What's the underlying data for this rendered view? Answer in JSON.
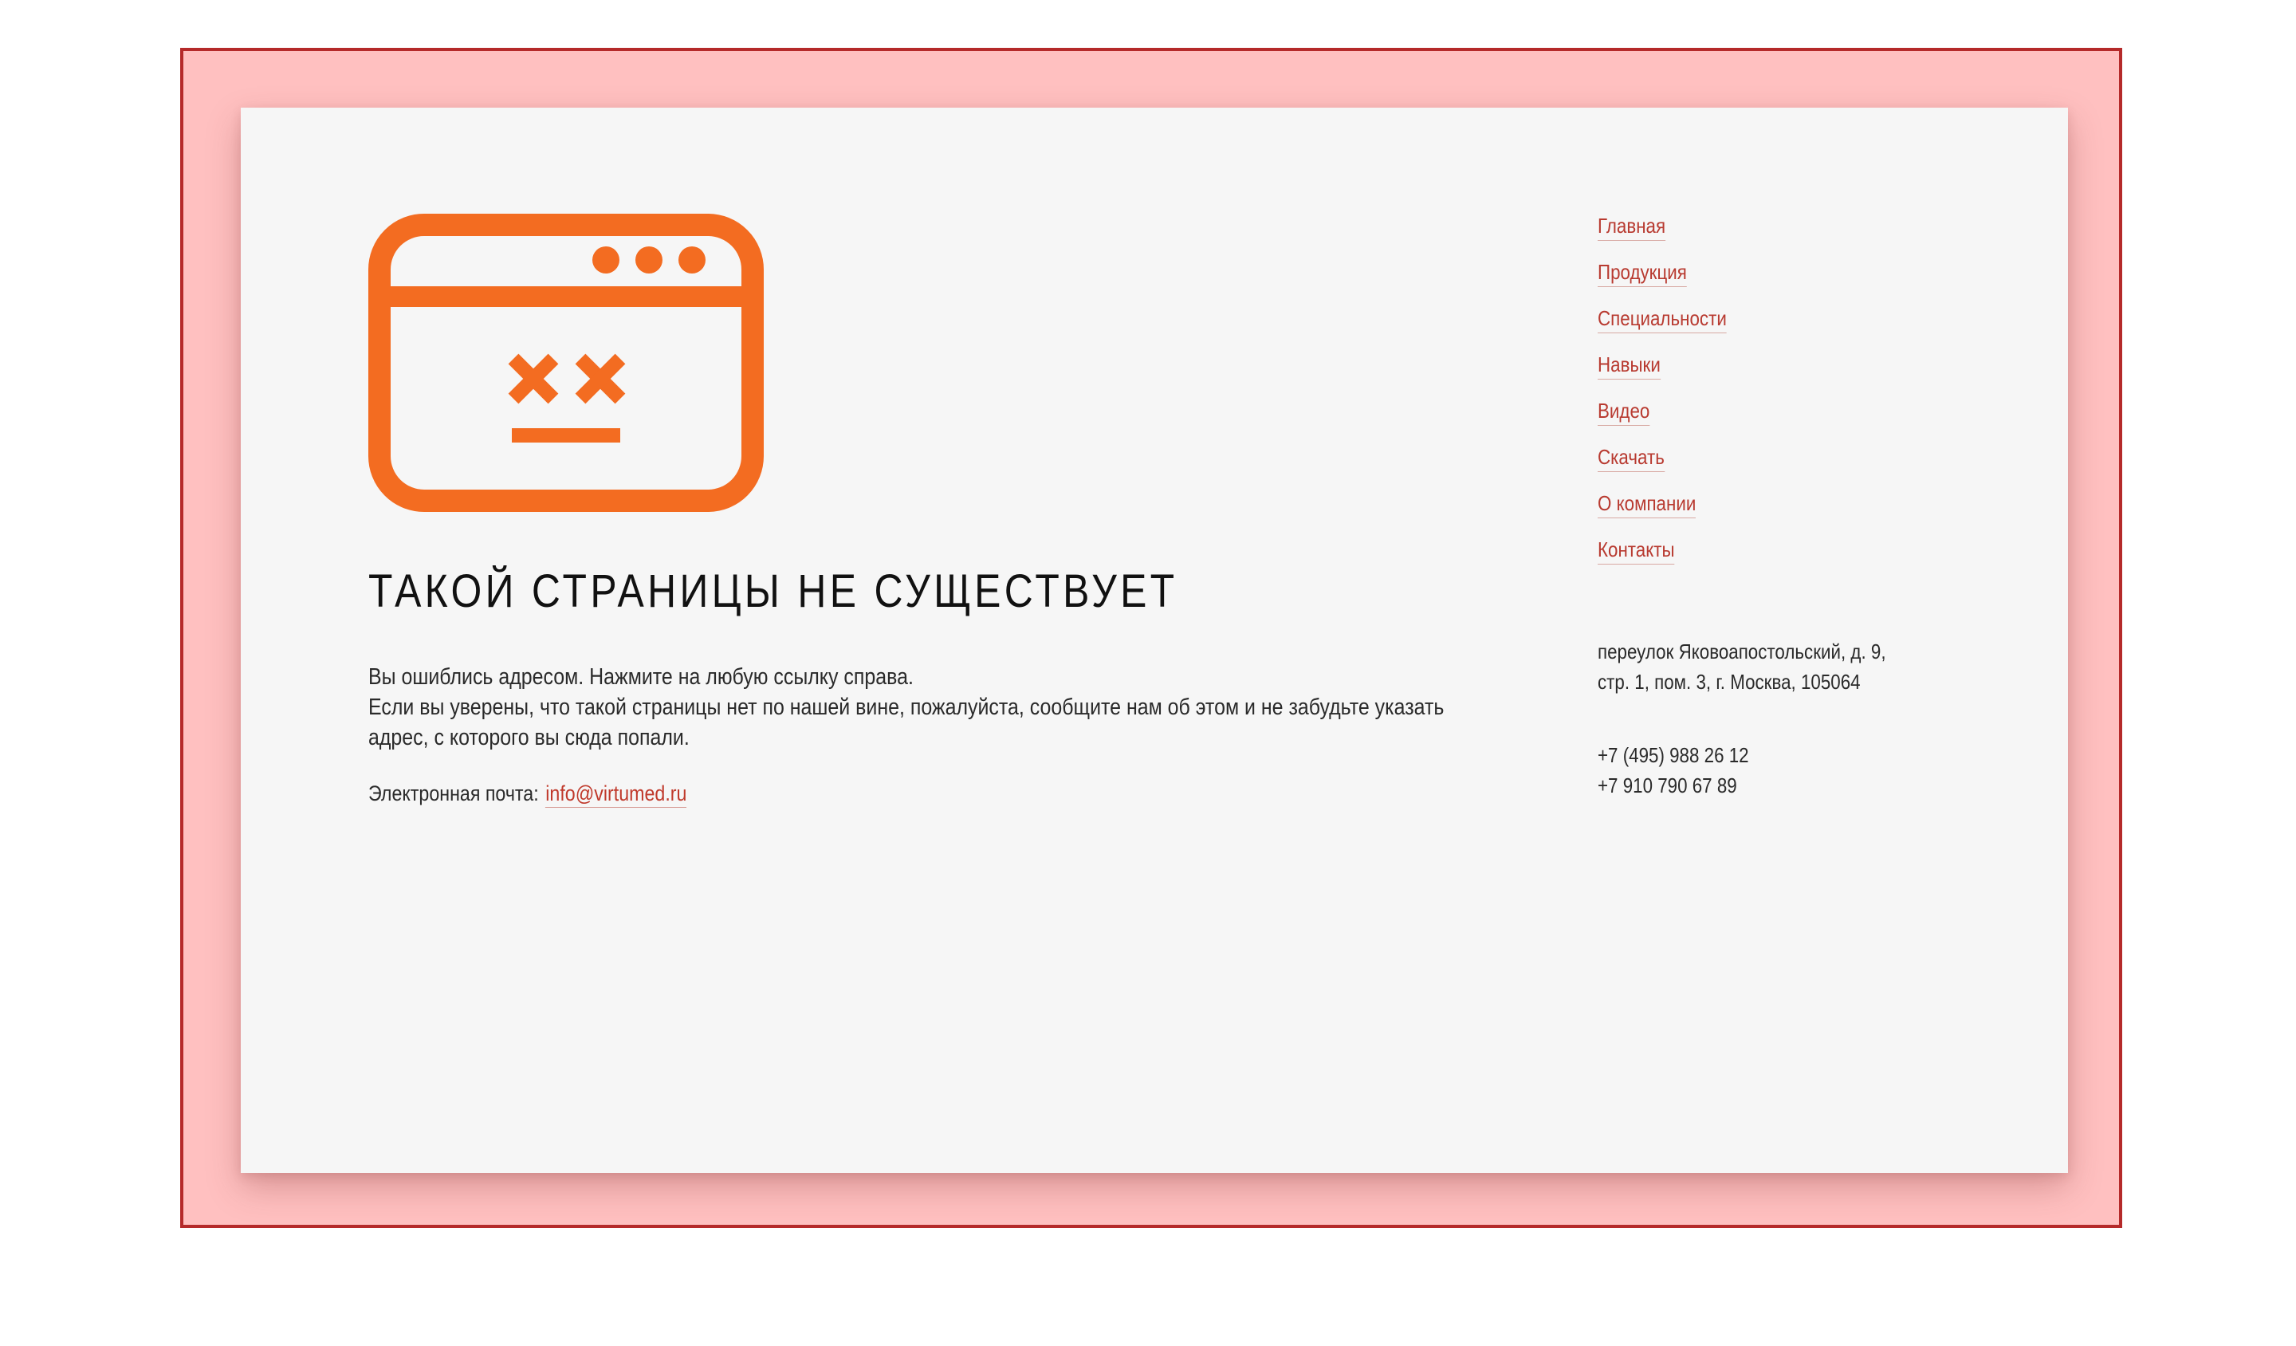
{
  "page": {
    "icon": "browser-error-icon",
    "accent_color": "#f36c21",
    "link_color": "#b83a30",
    "frame_color": "#ffc0c0"
  },
  "error": {
    "title": "ТАКОЙ СТРАНИЦЫ НЕ СУЩЕСТВУЕТ",
    "line1": "Вы ошиблись адресом. Нажмите на любую ссылку справа.",
    "line2": "Если вы уверены, что такой страницы нет по нашей вине, пожалуйста, сообщите нам об этом и не забудьте указать адрес, с которого вы сюда попали.",
    "email_label": "Электронная почта:",
    "email": "info@virtumed.ru"
  },
  "nav": {
    "items": [
      {
        "label": "Главная"
      },
      {
        "label": "Продукция"
      },
      {
        "label": "Специальности"
      },
      {
        "label": "Навыки"
      },
      {
        "label": "Видео"
      },
      {
        "label": "Скачать"
      },
      {
        "label": "О компании"
      },
      {
        "label": "Контакты"
      }
    ]
  },
  "contacts": {
    "address": "переулок Яковоапостольский, д. 9, стр. 1, пом. 3, г. Москва, 105064",
    "phone1": "+7 (495) 988 26 12",
    "phone2": "+7 910 790 67 89"
  }
}
